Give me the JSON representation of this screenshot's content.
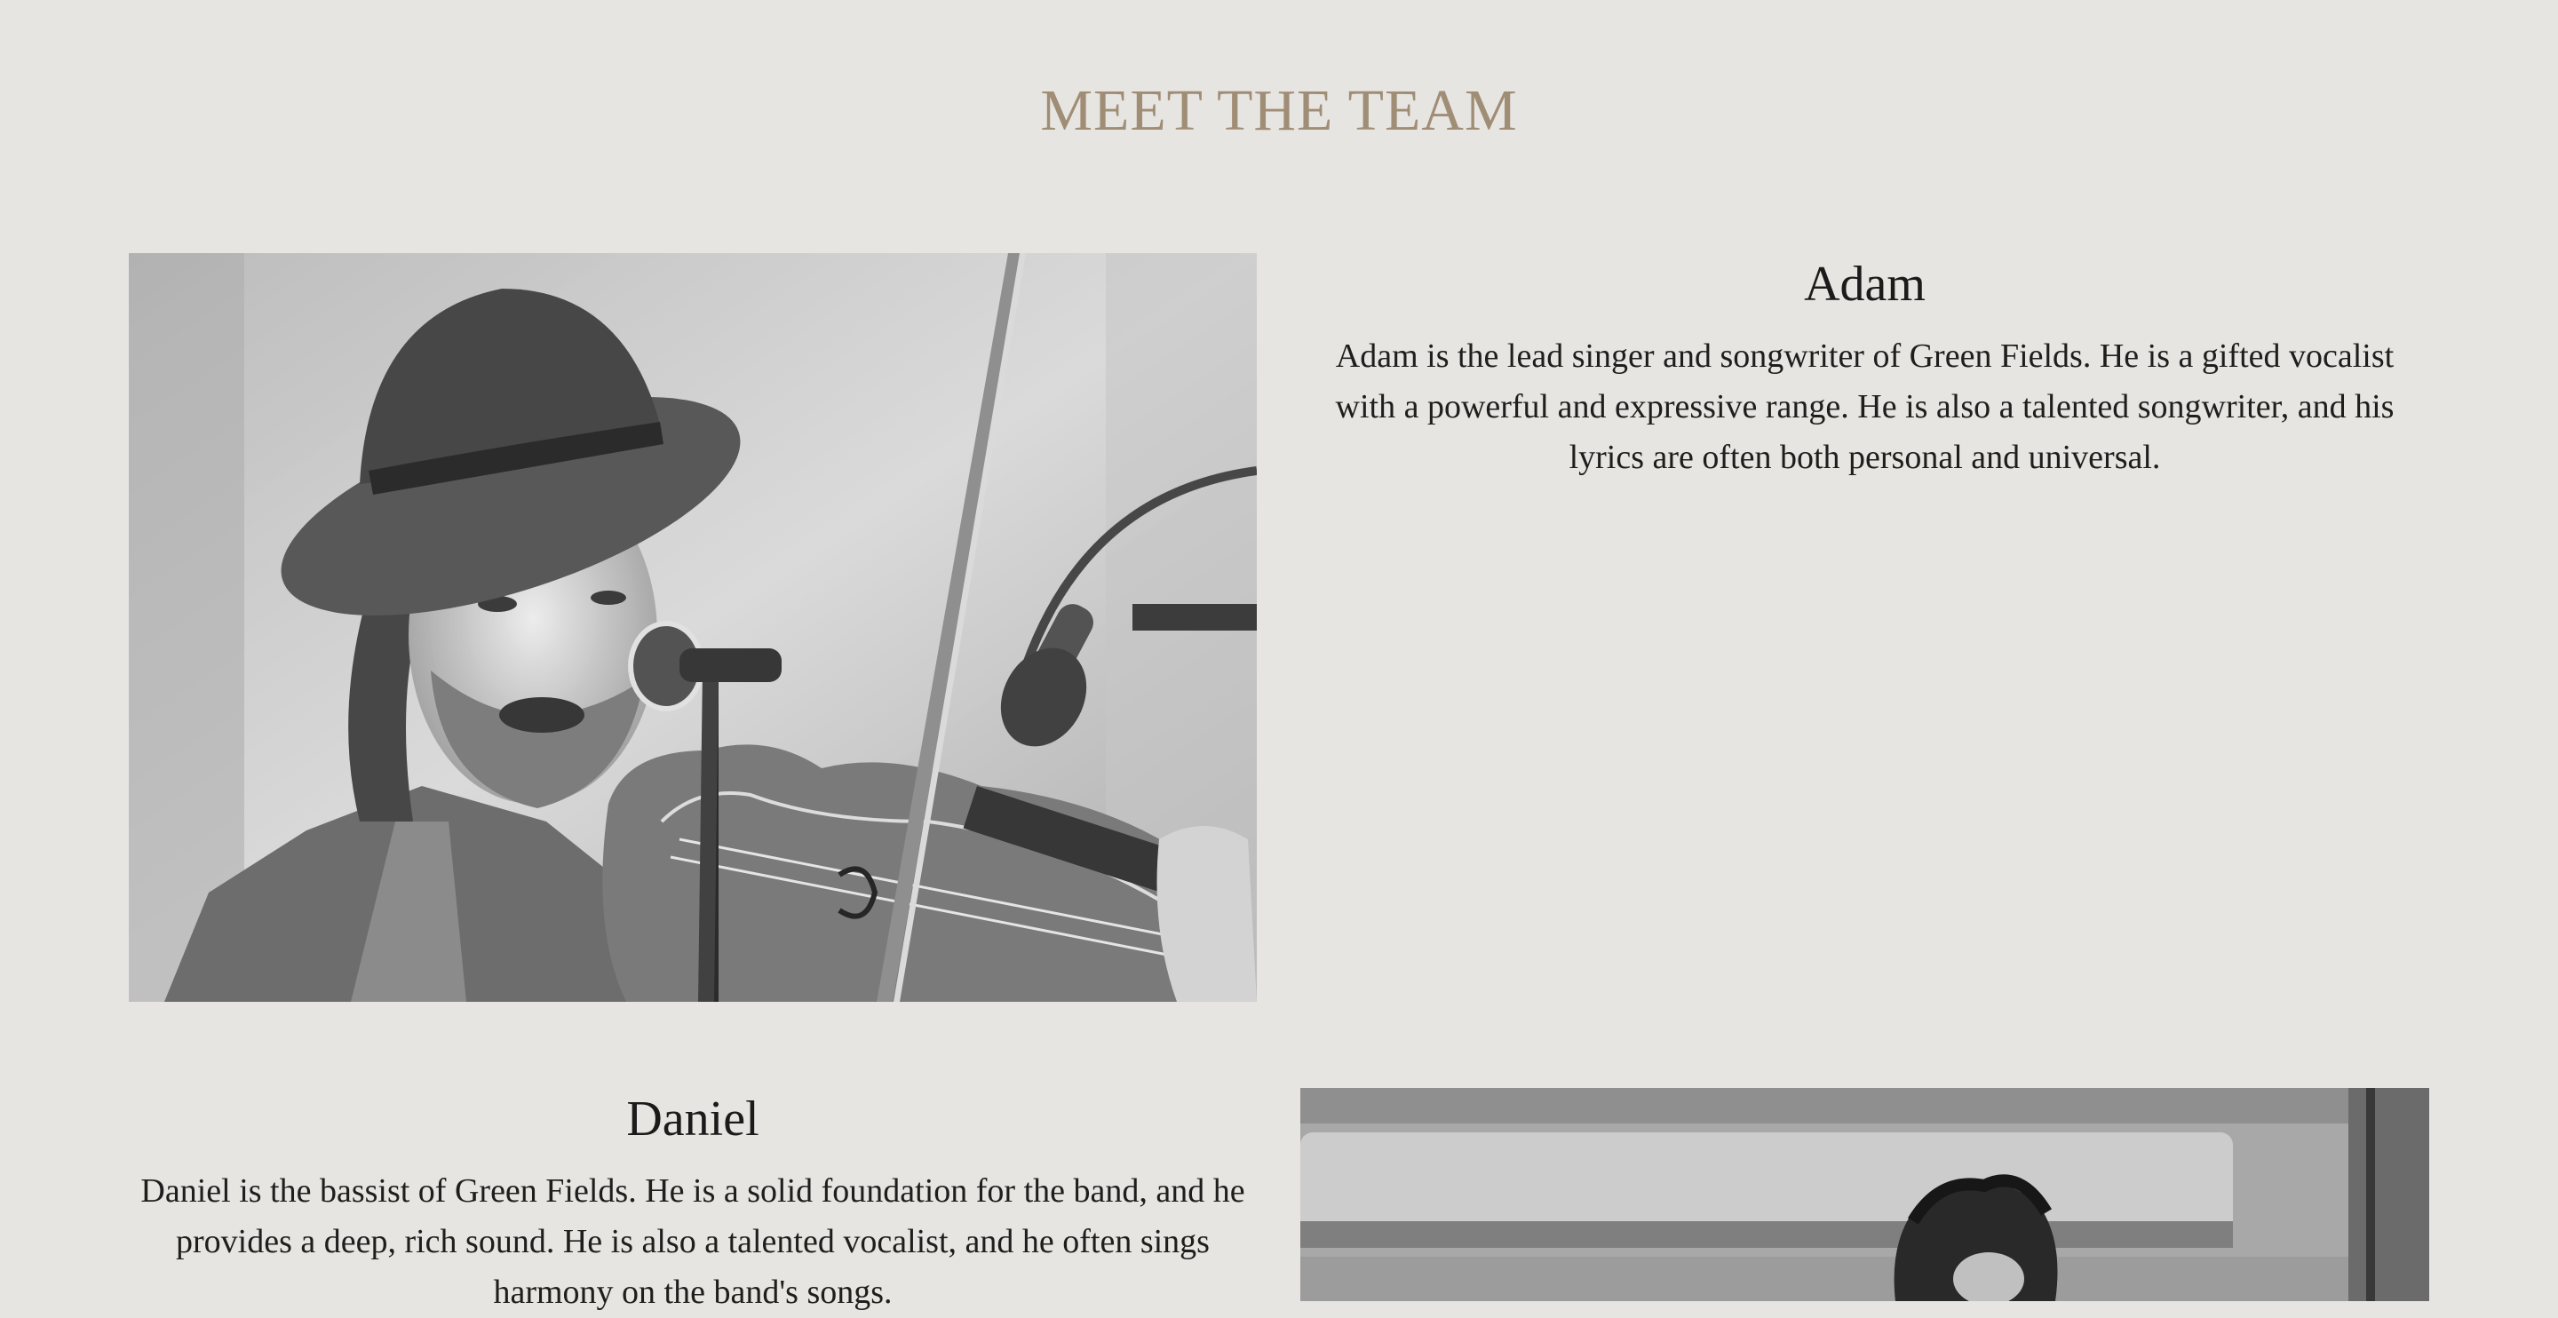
{
  "section": {
    "title": "MEET THE TEAM"
  },
  "members": [
    {
      "name": "Adam",
      "bio": "Adam is the lead singer and songwriter of Green Fields. He is a gifted vocalist with a powerful and expressive range. He is also a talented songwriter, and his lyrics are often both personal and universal."
    },
    {
      "name": "Daniel",
      "bio": "Daniel is the bassist of Green Fields. He is a solid foundation for the band, and he provides a deep, rich sound. He is also a talented vocalist, and he often sings harmony on the band's songs."
    }
  ],
  "colors": {
    "background": "#e7e5e1",
    "title": "#a08d75",
    "text": "#1d1d1d"
  }
}
